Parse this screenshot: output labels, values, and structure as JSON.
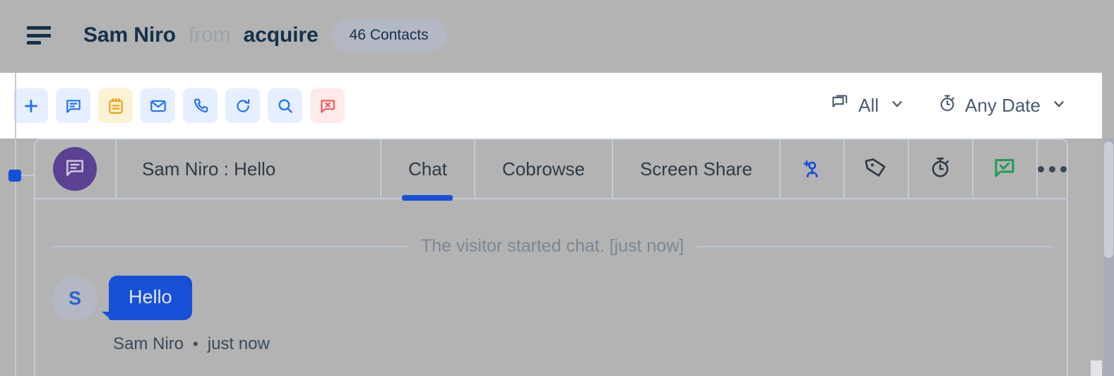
{
  "header": {
    "menu_icon": "hamburger-icon",
    "title_name": "Sam Niro",
    "title_from": "from",
    "title_org": "acquire",
    "contacts_badge": "46 Contacts"
  },
  "toolbar": {
    "buttons": [
      {
        "name": "add-button",
        "icon": "plus-icon",
        "tone": "blue"
      },
      {
        "name": "chat-button",
        "icon": "chat-bubble-icon",
        "tone": "blue"
      },
      {
        "name": "notes-button",
        "icon": "notepad-icon",
        "tone": "amber"
      },
      {
        "name": "email-button",
        "icon": "envelope-icon",
        "tone": "blue"
      },
      {
        "name": "call-button",
        "icon": "phone-icon",
        "tone": "blue"
      },
      {
        "name": "refresh-button",
        "icon": "refresh-icon",
        "tone": "blue"
      },
      {
        "name": "search-button",
        "icon": "search-icon",
        "tone": "blue"
      },
      {
        "name": "close-chat-button",
        "icon": "chat-close-icon",
        "tone": "red"
      }
    ],
    "filters": [
      {
        "name": "channel-filter",
        "icon": "chat-copy-icon",
        "label": "All",
        "caret": "chevron-down-icon"
      },
      {
        "name": "date-filter",
        "icon": "stopwatch-icon",
        "label": "Any Date",
        "caret": "chevron-down-icon"
      }
    ]
  },
  "conversation": {
    "avatar_icon": "chat-lines-icon",
    "subject": "Sam Niro : Hello",
    "tabs": [
      {
        "label": "Chat",
        "active": true
      },
      {
        "label": "Cobrowse",
        "active": false
      },
      {
        "label": "Screen Share",
        "active": false
      }
    ],
    "actions": [
      {
        "name": "add-contact-action",
        "icon": "person-add-icon"
      },
      {
        "name": "tag-action",
        "icon": "tag-icon"
      },
      {
        "name": "timer-action",
        "icon": "stopwatch-icon"
      },
      {
        "name": "resolve-action",
        "icon": "chat-check-icon"
      },
      {
        "name": "more-action",
        "icon": "more-horizontal-icon"
      }
    ]
  },
  "chat": {
    "system_message": "The visitor started chat. [just now]",
    "message": {
      "avatar_initial": "S",
      "text": "Hello",
      "sender": "Sam Niro",
      "separator": "•",
      "time": "just now"
    }
  },
  "colors": {
    "page_background": "#b3b3b3",
    "toolbar_background": "#ffffff",
    "accent_blue": "#1650d6",
    "icon_blue": "#2272f5",
    "icon_amber": "#e8a21a",
    "icon_red": "#f0545c",
    "icon_green": "#1f9d55",
    "avatar_purple": "#5b4192",
    "text_dark": "#15304b",
    "text_muted": "#7b8796",
    "border": "#c3cbdb"
  }
}
